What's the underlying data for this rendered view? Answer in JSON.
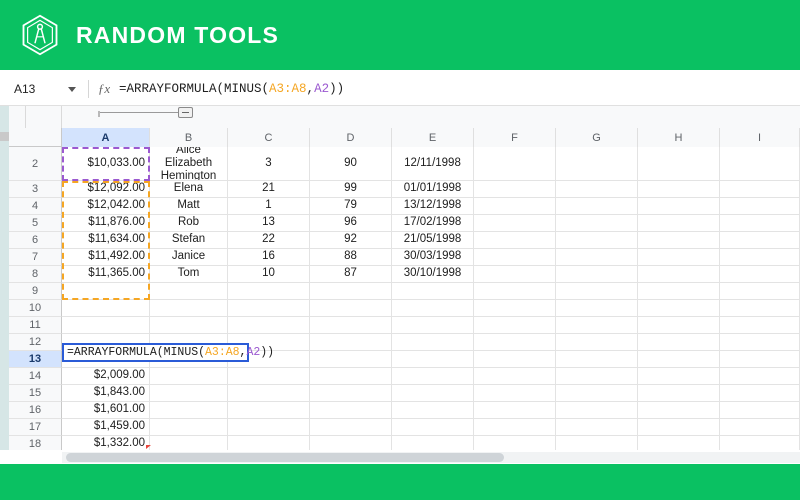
{
  "brand": {
    "title": "RANDOM TOOLS",
    "logo_icon": "hexagon-compass-icon",
    "color": "#0ac162"
  },
  "formula_bar": {
    "name_box_value": "A13",
    "name_box_icon": "chevron-down-icon",
    "fx_icon": "fx-icon",
    "formula": "=ARRAYFORMULA(MINUS(A3:A8,A2))",
    "formula_parts": {
      "prefix": "=ARRAYFORMULA(MINUS(",
      "ref1": "A3:A8",
      "separator": ",",
      "ref2": "A2",
      "suffix": "))"
    },
    "ref1_color": "#f5a623",
    "ref2_color": "#9b59d0"
  },
  "grid": {
    "columns": [
      "A",
      "B",
      "C",
      "D",
      "E",
      "F",
      "G",
      "H",
      "I"
    ],
    "selected_column": "A",
    "selected_row": "13",
    "rows": [
      {
        "n": "2",
        "A": "$10,033.00",
        "B": "Alice Elizabeth Hemington",
        "C": "3",
        "D": "90",
        "E": "12/11/1998"
      },
      {
        "n": "3",
        "A": "$12,092.00",
        "B": "Elena",
        "C": "21",
        "D": "99",
        "E": "01/01/1998"
      },
      {
        "n": "4",
        "A": "$12,042.00",
        "B": "Matt",
        "C": "1",
        "D": "79",
        "E": "13/12/1998"
      },
      {
        "n": "5",
        "A": "$11,876.00",
        "B": "Rob",
        "C": "13",
        "D": "96",
        "E": "17/02/1998"
      },
      {
        "n": "6",
        "A": "$11,634.00",
        "B": "Stefan",
        "C": "22",
        "D": "92",
        "E": "21/05/1998"
      },
      {
        "n": "7",
        "A": "$11,492.00",
        "B": "Janice",
        "C": "16",
        "D": "88",
        "E": "30/03/1998"
      },
      {
        "n": "8",
        "A": "$11,365.00",
        "B": "Tom",
        "C": "10",
        "D": "87",
        "E": "30/10/1998"
      },
      {
        "n": "9",
        "A": "",
        "B": "",
        "C": "",
        "D": "",
        "E": ""
      },
      {
        "n": "10",
        "A": "",
        "B": "",
        "C": "",
        "D": "",
        "E": ""
      },
      {
        "n": "11",
        "A": "",
        "B": "",
        "C": "",
        "D": "",
        "E": ""
      },
      {
        "n": "12",
        "A": "",
        "B": "",
        "C": "",
        "D": "",
        "E": ""
      },
      {
        "n": "13",
        "A": "",
        "B": "",
        "C": "",
        "D": "",
        "E": ""
      },
      {
        "n": "14",
        "A": "$2,009.00",
        "B": "",
        "C": "",
        "D": "",
        "E": ""
      },
      {
        "n": "15",
        "A": "$1,843.00",
        "B": "",
        "C": "",
        "D": "",
        "E": ""
      },
      {
        "n": "16",
        "A": "$1,601.00",
        "B": "",
        "C": "",
        "D": "",
        "E": ""
      },
      {
        "n": "17",
        "A": "$1,459.00",
        "B": "",
        "C": "",
        "D": "",
        "E": ""
      },
      {
        "n": "18",
        "A": "$1,332.00",
        "B": "",
        "C": "",
        "D": "",
        "E": ""
      }
    ],
    "active_cell_editor": {
      "cell": "A13",
      "text": "=ARRAYFORMULA(MINUS(A3:A8,A2))",
      "prefix": "=ARRAYFORMULA(MINUS(",
      "ref1": "A3:A8",
      "separator": ",",
      "ref2": "A2",
      "suffix": "))"
    },
    "range_highlights": [
      {
        "range": "A2",
        "color": "#9b59d0",
        "style": "dashed"
      },
      {
        "range": "A3:A8",
        "color": "#f5a623",
        "style": "dashed"
      }
    ]
  }
}
